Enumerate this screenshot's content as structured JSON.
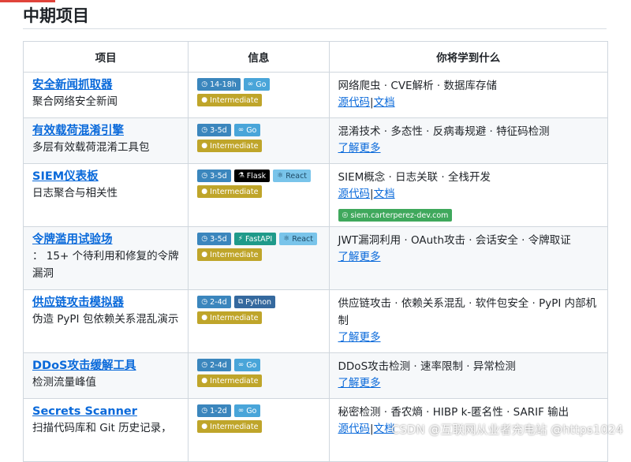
{
  "section": {
    "title": "中期项目"
  },
  "table": {
    "headers": [
      "项目",
      "信息",
      "你将学到什么"
    ],
    "rows": [
      {
        "name": "安全新闻抓取器",
        "desc": "聚合网络安全新闻",
        "badges": [
          {
            "text": "14-18h",
            "kind": "time",
            "icon": "clock-icon"
          },
          {
            "text": "Go",
            "kind": "go",
            "icon": "go-icon"
          },
          {
            "text": "Intermediate",
            "kind": "level",
            "icon": "dot-icon"
          }
        ],
        "learn": "网络爬虫 · CVE解析 · 数据库存储",
        "link1": "源代码",
        "link2": "文档"
      },
      {
        "name": "有效载荷混淆引擎",
        "desc": "多层有效载荷混淆工具包",
        "badges": [
          {
            "text": "3-5d",
            "kind": "time",
            "icon": "clock-icon"
          },
          {
            "text": "Go",
            "kind": "go",
            "icon": "go-icon"
          },
          {
            "text": "Intermediate",
            "kind": "level",
            "icon": "dot-icon"
          }
        ],
        "learn": "混淆技术 · 多态性 · 反病毒规避 · 特征码检测",
        "more": "了解更多"
      },
      {
        "name": "SIEM仪表板",
        "desc": "日志聚合与相关性",
        "badges": [
          {
            "text": "3-5d",
            "kind": "time",
            "icon": "clock-icon"
          },
          {
            "text": "Flask",
            "kind": "flask",
            "icon": "flask-icon"
          },
          {
            "text": "React",
            "kind": "react",
            "icon": "react-icon"
          },
          {
            "text": "Intermediate",
            "kind": "level",
            "icon": "dot-icon"
          }
        ],
        "learn": "SIEM概念 · 日志关联 · 全栈开发",
        "link1": "源代码",
        "link2": "文档",
        "site": "siem.carterperez-dev.com"
      },
      {
        "name": "令牌滥用试验场",
        "desc": "： 15+ 个待利用和修复的令牌漏洞",
        "badges": [
          {
            "text": "3-5d",
            "kind": "time",
            "icon": "clock-icon"
          },
          {
            "text": "FastAPI",
            "kind": "fast",
            "icon": "fastapi-icon"
          },
          {
            "text": "React",
            "kind": "react",
            "icon": "react-icon"
          },
          {
            "text": "Intermediate",
            "kind": "level",
            "icon": "dot-icon"
          }
        ],
        "learn": "JWT漏洞利用 · OAuth攻击 · 会话安全 · 令牌取证",
        "more": "了解更多"
      },
      {
        "name": "供应链攻击模拟器",
        "desc": "伪造 PyPI 包依赖关系混乱演示",
        "badges": [
          {
            "text": "2-4d",
            "kind": "time",
            "icon": "clock-icon"
          },
          {
            "text": "Python",
            "kind": "py",
            "icon": "python-icon"
          },
          {
            "text": "Intermediate",
            "kind": "level",
            "icon": "dot-icon"
          }
        ],
        "learn": "供应链攻击 · 依赖关系混乱 · 软件包安全 · PyPI 内部机制",
        "more": "了解更多"
      },
      {
        "name": "DDoS攻击缓解工具",
        "desc": "检测流量峰值",
        "badges": [
          {
            "text": "2-4d",
            "kind": "time",
            "icon": "clock-icon"
          },
          {
            "text": "Go",
            "kind": "go",
            "icon": "go-icon"
          },
          {
            "text": "Intermediate",
            "kind": "level",
            "icon": "dot-icon"
          }
        ],
        "learn": "DDoS攻击检测 · 速率限制 · 异常检测",
        "more": "了解更多"
      },
      {
        "name": "Secrets Scanner",
        "desc": "扫描代码库和 Git 历史记录，",
        "badges": [
          {
            "text": "1-2d",
            "kind": "time",
            "icon": "clock-icon"
          },
          {
            "text": "Go",
            "kind": "go",
            "icon": "go-icon"
          },
          {
            "text": "Intermediate",
            "kind": "level",
            "icon": "dot-icon"
          }
        ],
        "learn": "秘密检测 · 香农熵 · HIBP k-匿名性 · SARIF 输出",
        "link1": "源代码",
        "link2": "文档"
      }
    ]
  },
  "watermark": "CSDN @互联网从业者充电站 @https1024"
}
